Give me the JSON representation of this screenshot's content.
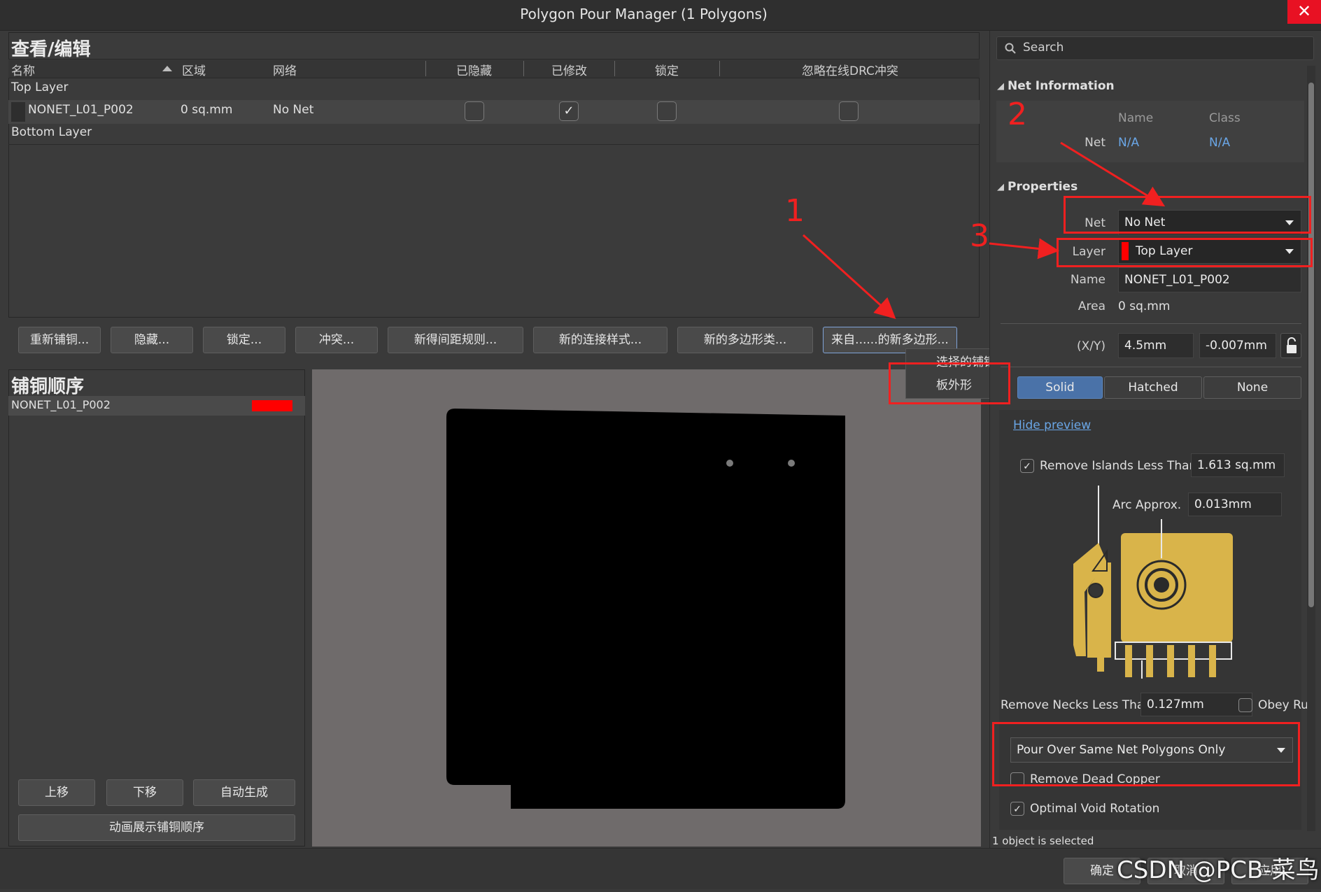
{
  "window": {
    "title": "Polygon Pour Manager (1 Polygons)",
    "close_glyph": "✕"
  },
  "view_edit": {
    "title": "查看/编辑",
    "columns": [
      "名称",
      "区域",
      "网络",
      "已隐藏",
      "已修改",
      "锁定",
      "忽略在线DRC冲突"
    ],
    "groups": [
      "Top Layer",
      "Bottom Layer"
    ],
    "row": {
      "name": "NONET_L01_P002",
      "area": "0 sq.mm",
      "net": "No Net",
      "hidden": false,
      "modified": true,
      "locked": false,
      "ignore_drc": false
    }
  },
  "toolbar": [
    "重新铺铜...",
    "隐藏...",
    "锁定...",
    "冲突...",
    "新得间距规则...",
    "新的连接样式...",
    "新的多边形类...",
    "来自......的新多边形..."
  ],
  "popup_menu": {
    "items": [
      "选择的铺铜",
      "板外形"
    ]
  },
  "pour_order": {
    "title": "铺铜顺序",
    "item": "NONET_L01_P002",
    "color": "#ff0000",
    "btn_up": "上移",
    "btn_down": "下移",
    "btn_auto": "自动生成",
    "btn_animate": "动画展示铺铜顺序"
  },
  "right": {
    "search_placeholder": "Search",
    "net_info": {
      "title": "Net Information",
      "col_name": "Name",
      "col_class": "Class",
      "row_label": "Net",
      "name_value": "N/A",
      "class_value": "N/A"
    },
    "properties": {
      "title": "Properties",
      "net_label": "Net",
      "net_value": "No Net",
      "layer_label": "Layer",
      "layer_value": "Top Layer",
      "layer_color": "#ff0000",
      "name_label": "Name",
      "name_value": "NONET_L01_P002",
      "area_label": "Area",
      "area_value": "0 sq.mm",
      "xy_label": "(X/Y)",
      "x_value": "4.5mm",
      "y_value": "-0.007mm"
    },
    "fill_modes": [
      "Solid",
      "Hatched",
      "None"
    ],
    "hide_preview": "Hide preview",
    "remove_islands_label": "Remove Islands Less Than",
    "remove_islands_value": "1.613 sq.mm",
    "arc_label": "Arc Approx.",
    "arc_value": "0.013mm",
    "remove_necks_label": "Remove Necks Less Than",
    "remove_necks_value": "0.127mm",
    "obey_label": "Obey Ru",
    "pour_over_value": "Pour Over Same Net Polygons Only",
    "remove_dead_label": "Remove Dead Copper",
    "optimal_void_label": "Optimal Void Rotation",
    "status": "1 object is selected"
  },
  "bottom": {
    "ok": "确定",
    "cancel": "取消",
    "apply": "应用"
  },
  "annotations": {
    "n1": "1",
    "n2": "2",
    "n3": "3"
  },
  "watermark": "CSDN @PCB-菜鸟",
  "accent": "#4a72a8"
}
